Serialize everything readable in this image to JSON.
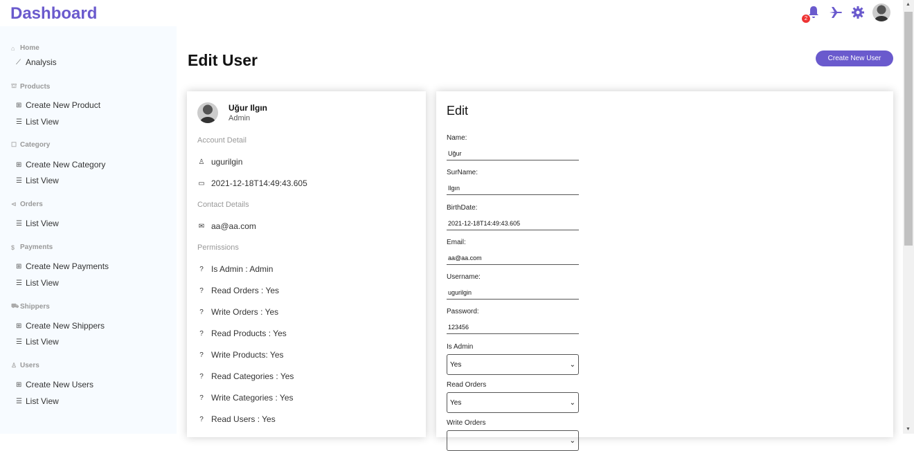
{
  "header": {
    "logo": "Dashboard",
    "notification_count": "2"
  },
  "sidebar": {
    "home": {
      "title": "Home",
      "items": [
        "Analysis"
      ]
    },
    "products": {
      "title": "Products",
      "items": [
        "Create New Product",
        "List View"
      ]
    },
    "category": {
      "title": "Category",
      "items": [
        "Create New Category",
        "List View"
      ]
    },
    "orders": {
      "title": "Orders",
      "items": [
        "List View"
      ]
    },
    "payments": {
      "title": "Payments",
      "items": [
        "Create New Payments",
        "List View"
      ]
    },
    "shippers": {
      "title": "Shippers",
      "items": [
        "Create New Shippers",
        "List View"
      ]
    },
    "users": {
      "title": "Users",
      "items": [
        "Create New Users",
        "List View"
      ]
    }
  },
  "main": {
    "title": "Edit User",
    "create_button": "Create New User"
  },
  "user_card": {
    "name": "Uğur Ilgın",
    "role": "Admin",
    "account_title": "Account Detail",
    "username": "ugurilgin",
    "date": "2021-12-18T14:49:43.605",
    "contact_title": "Contact Details",
    "email": "aa@aa.com",
    "permissions_title": "Permissions",
    "permissions": [
      "Is Admin : Admin",
      "Read Orders : Yes",
      "Write Orders : Yes",
      "Read Products : Yes",
      "Write Products: Yes",
      "Read Categories : Yes",
      "Write Categories : Yes",
      "Read Users : Yes"
    ]
  },
  "edit_form": {
    "title": "Edit",
    "fields": [
      {
        "label": "Name:",
        "value": "Uğur"
      },
      {
        "label": "SurName:",
        "value": "Ilgın"
      },
      {
        "label": "BirthDate:",
        "value": "2021-12-18T14:49:43.605"
      },
      {
        "label": "Email:",
        "value": "aa@aa.com"
      },
      {
        "label": "Username:",
        "value": "ugurilgin"
      },
      {
        "label": "Password:",
        "value": "123456"
      }
    ],
    "selects": [
      {
        "label": "Is Admin",
        "value": "Yes"
      },
      {
        "label": "Read Orders",
        "value": "Yes"
      },
      {
        "label": "Write Orders",
        "value": ""
      }
    ]
  },
  "colors": {
    "accent": "#6a5acd",
    "badge": "#e33333",
    "sidebar_bg": "#f7fbff"
  }
}
